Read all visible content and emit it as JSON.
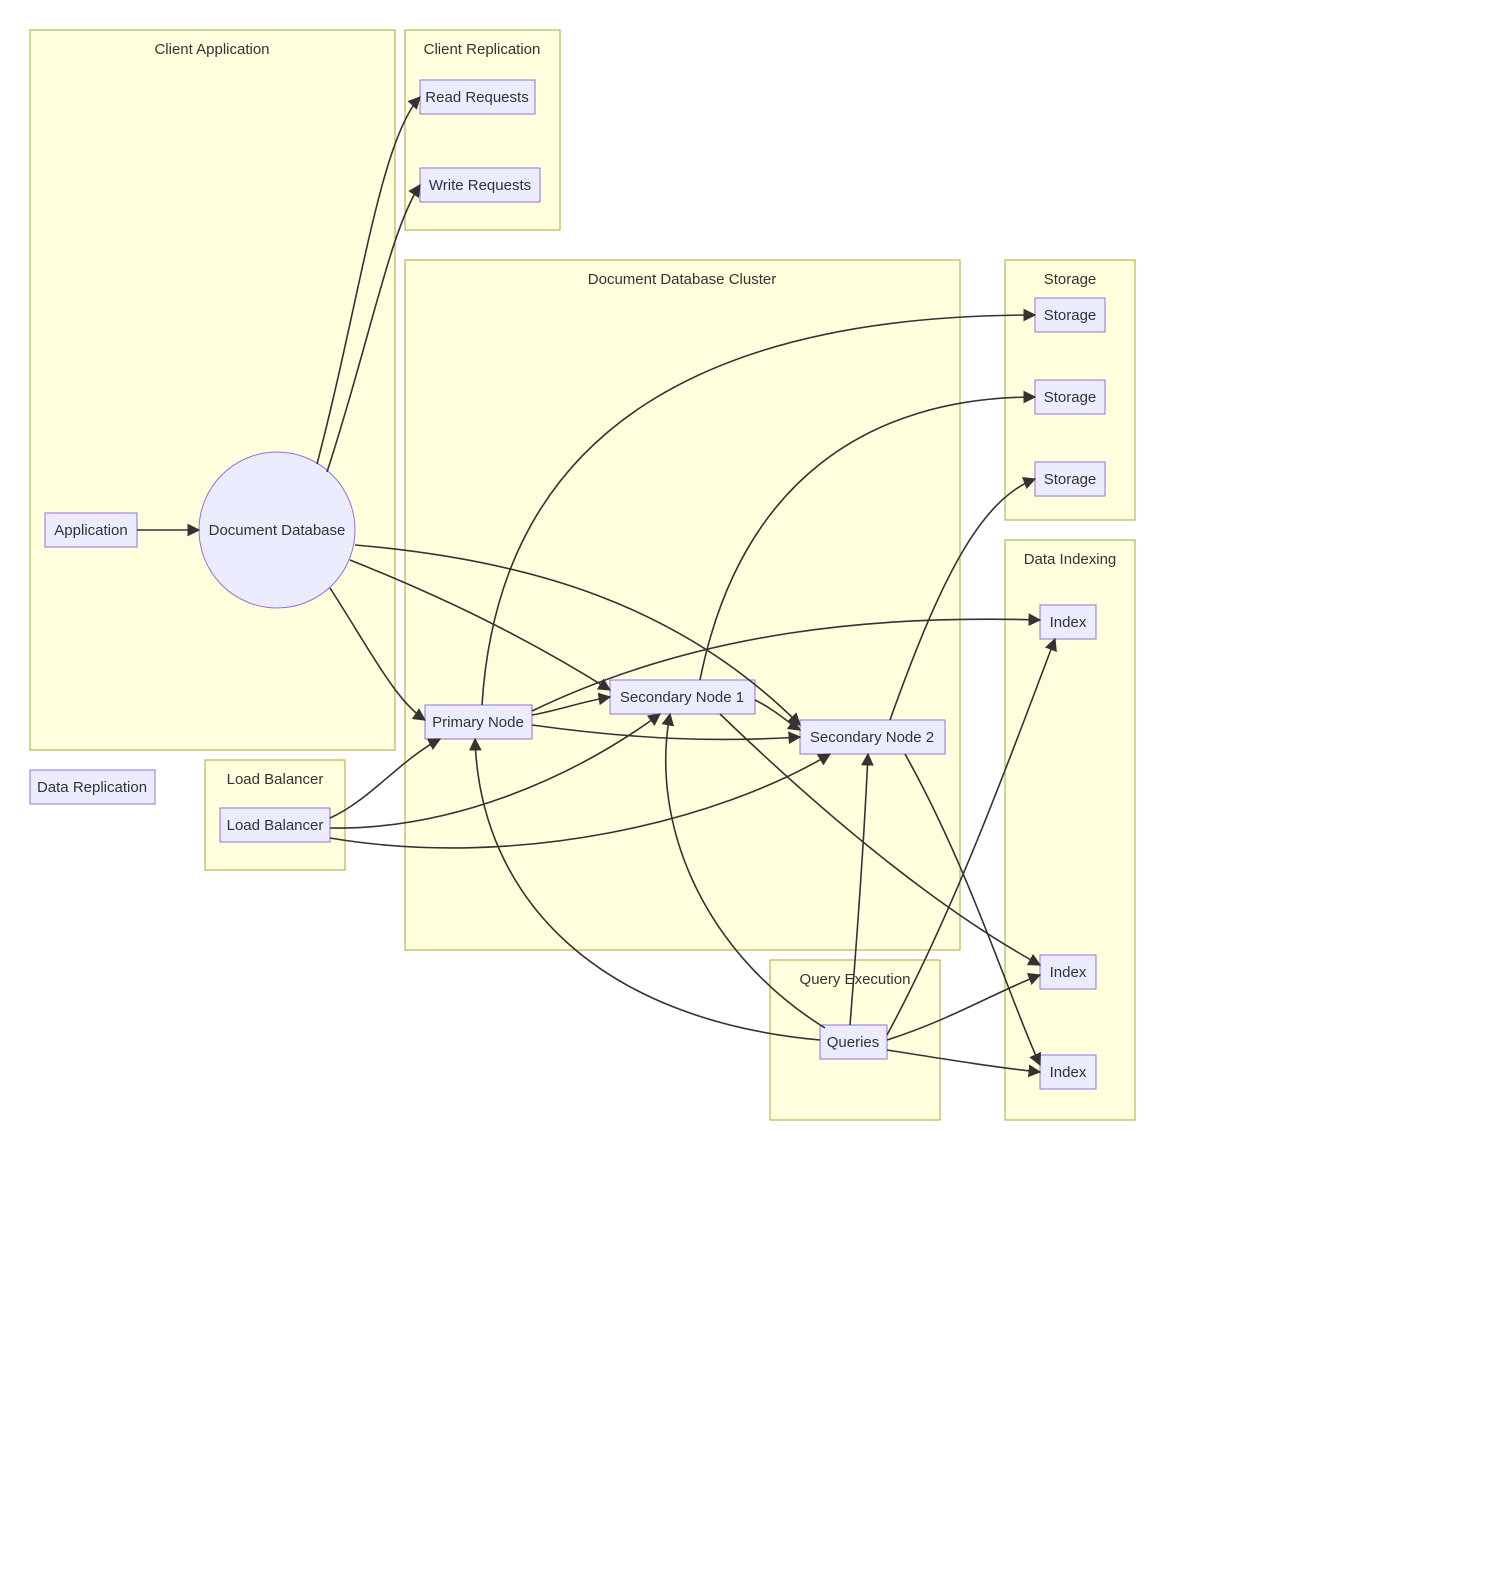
{
  "subgraphs": {
    "client_app": {
      "title": "Client Application"
    },
    "client_repl": {
      "title": "Client Replication"
    },
    "doc_cluster": {
      "title": "Document Database Cluster"
    },
    "storage_g": {
      "title": "Storage"
    },
    "data_indexing": {
      "title": "Data Indexing"
    },
    "load_balancer_g": {
      "title": "Load Balancer"
    },
    "query_exec": {
      "title": "Query Execution"
    }
  },
  "nodes": {
    "application": {
      "label": "Application"
    },
    "doc_db": {
      "label": "Document Database"
    },
    "read_req": {
      "label": "Read Requests"
    },
    "write_req": {
      "label": "Write Requests"
    },
    "primary": {
      "label": "Primary Node"
    },
    "secondary1": {
      "label": "Secondary Node 1"
    },
    "secondary2": {
      "label": "Secondary Node 2"
    },
    "storage1": {
      "label": "Storage"
    },
    "storage2": {
      "label": "Storage"
    },
    "storage3": {
      "label": "Storage"
    },
    "index1": {
      "label": "Index"
    },
    "index2": {
      "label": "Index"
    },
    "index3": {
      "label": "Index"
    },
    "load_balancer": {
      "label": "Load Balancer"
    },
    "queries": {
      "label": "Queries"
    },
    "data_replication": {
      "label": "Data Replication"
    }
  }
}
